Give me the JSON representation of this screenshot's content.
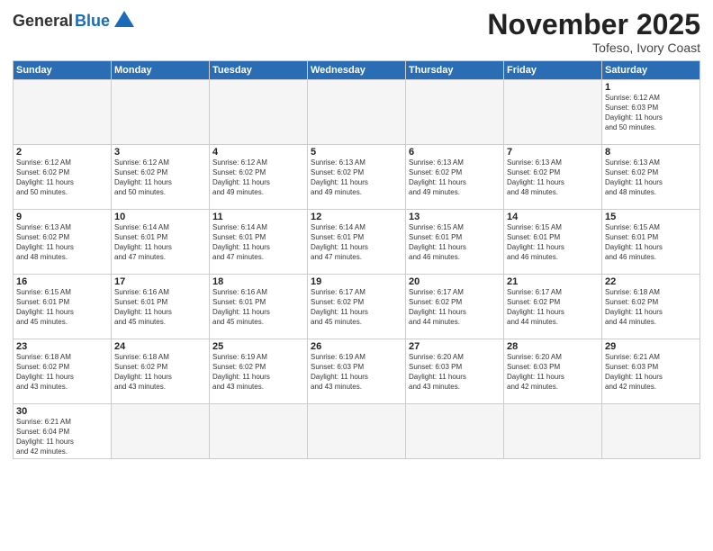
{
  "header": {
    "logo_general": "General",
    "logo_blue": "Blue",
    "month_title": "November 2025",
    "subtitle": "Tofeso, Ivory Coast"
  },
  "weekdays": [
    "Sunday",
    "Monday",
    "Tuesday",
    "Wednesday",
    "Thursday",
    "Friday",
    "Saturday"
  ],
  "days": {
    "1": {
      "sunrise": "6:12 AM",
      "sunset": "6:03 PM",
      "daylight": "11 hours and 50 minutes."
    },
    "2": {
      "sunrise": "6:12 AM",
      "sunset": "6:02 PM",
      "daylight": "11 hours and 50 minutes."
    },
    "3": {
      "sunrise": "6:12 AM",
      "sunset": "6:02 PM",
      "daylight": "11 hours and 50 minutes."
    },
    "4": {
      "sunrise": "6:12 AM",
      "sunset": "6:02 PM",
      "daylight": "11 hours and 49 minutes."
    },
    "5": {
      "sunrise": "6:13 AM",
      "sunset": "6:02 PM",
      "daylight": "11 hours and 49 minutes."
    },
    "6": {
      "sunrise": "6:13 AM",
      "sunset": "6:02 PM",
      "daylight": "11 hours and 49 minutes."
    },
    "7": {
      "sunrise": "6:13 AM",
      "sunset": "6:02 PM",
      "daylight": "11 hours and 48 minutes."
    },
    "8": {
      "sunrise": "6:13 AM",
      "sunset": "6:02 PM",
      "daylight": "11 hours and 48 minutes."
    },
    "9": {
      "sunrise": "6:13 AM",
      "sunset": "6:02 PM",
      "daylight": "11 hours and 48 minutes."
    },
    "10": {
      "sunrise": "6:14 AM",
      "sunset": "6:01 PM",
      "daylight": "11 hours and 47 minutes."
    },
    "11": {
      "sunrise": "6:14 AM",
      "sunset": "6:01 PM",
      "daylight": "11 hours and 47 minutes."
    },
    "12": {
      "sunrise": "6:14 AM",
      "sunset": "6:01 PM",
      "daylight": "11 hours and 47 minutes."
    },
    "13": {
      "sunrise": "6:15 AM",
      "sunset": "6:01 PM",
      "daylight": "11 hours and 46 minutes."
    },
    "14": {
      "sunrise": "6:15 AM",
      "sunset": "6:01 PM",
      "daylight": "11 hours and 46 minutes."
    },
    "15": {
      "sunrise": "6:15 AM",
      "sunset": "6:01 PM",
      "daylight": "11 hours and 46 minutes."
    },
    "16": {
      "sunrise": "6:15 AM",
      "sunset": "6:01 PM",
      "daylight": "11 hours and 45 minutes."
    },
    "17": {
      "sunrise": "6:16 AM",
      "sunset": "6:01 PM",
      "daylight": "11 hours and 45 minutes."
    },
    "18": {
      "sunrise": "6:16 AM",
      "sunset": "6:01 PM",
      "daylight": "11 hours and 45 minutes."
    },
    "19": {
      "sunrise": "6:17 AM",
      "sunset": "6:02 PM",
      "daylight": "11 hours and 45 minutes."
    },
    "20": {
      "sunrise": "6:17 AM",
      "sunset": "6:02 PM",
      "daylight": "11 hours and 44 minutes."
    },
    "21": {
      "sunrise": "6:17 AM",
      "sunset": "6:02 PM",
      "daylight": "11 hours and 44 minutes."
    },
    "22": {
      "sunrise": "6:18 AM",
      "sunset": "6:02 PM",
      "daylight": "11 hours and 44 minutes."
    },
    "23": {
      "sunrise": "6:18 AM",
      "sunset": "6:02 PM",
      "daylight": "11 hours and 43 minutes."
    },
    "24": {
      "sunrise": "6:18 AM",
      "sunset": "6:02 PM",
      "daylight": "11 hours and 43 minutes."
    },
    "25": {
      "sunrise": "6:19 AM",
      "sunset": "6:02 PM",
      "daylight": "11 hours and 43 minutes."
    },
    "26": {
      "sunrise": "6:19 AM",
      "sunset": "6:03 PM",
      "daylight": "11 hours and 43 minutes."
    },
    "27": {
      "sunrise": "6:20 AM",
      "sunset": "6:03 PM",
      "daylight": "11 hours and 43 minutes."
    },
    "28": {
      "sunrise": "6:20 AM",
      "sunset": "6:03 PM",
      "daylight": "11 hours and 42 minutes."
    },
    "29": {
      "sunrise": "6:21 AM",
      "sunset": "6:03 PM",
      "daylight": "11 hours and 42 minutes."
    },
    "30": {
      "sunrise": "6:21 AM",
      "sunset": "6:04 PM",
      "daylight": "11 hours and 42 minutes."
    }
  }
}
